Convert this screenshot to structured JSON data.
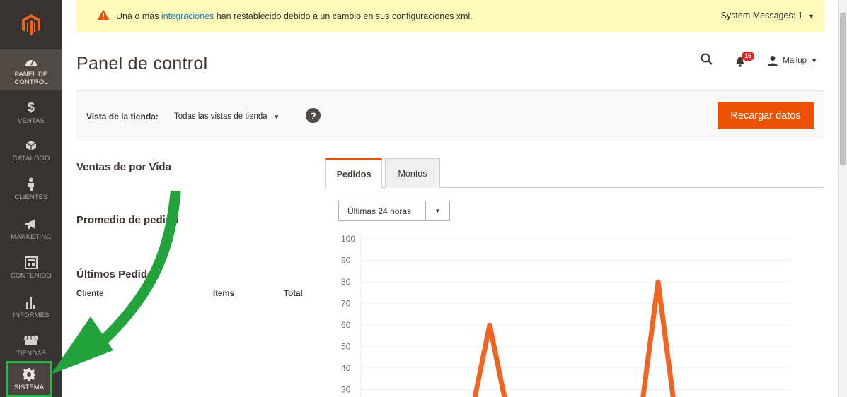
{
  "sidebar": {
    "items": [
      {
        "label_line1": "PANEL DE",
        "label_line2": "CONTROL",
        "icon": "dashboard-icon"
      },
      {
        "label_line1": "VENTAS",
        "label_line2": "",
        "icon": "dollar-icon"
      },
      {
        "label_line1": "CATÁLOGO",
        "label_line2": "",
        "icon": "cube-icon"
      },
      {
        "label_line1": "CLIENTES",
        "label_line2": "",
        "icon": "person-icon"
      },
      {
        "label_line1": "MARKETING",
        "label_line2": "",
        "icon": "megaphone-icon"
      },
      {
        "label_line1": "CONTENIDO",
        "label_line2": "",
        "icon": "layout-icon"
      },
      {
        "label_line1": "INFORMES",
        "label_line2": "",
        "icon": "bar-chart-icon"
      },
      {
        "label_line1": "TIENDAS",
        "label_line2": "",
        "icon": "store-icon"
      },
      {
        "label_line1": "SISTEMA",
        "label_line2": "",
        "icon": "gear-icon"
      }
    ]
  },
  "system_message": {
    "text_before": "Una o más ",
    "link": "integraciones",
    "text_after": " han restablecido debido a un cambio en sus configuraciones xml.",
    "counter": "System Messages: 1"
  },
  "header": {
    "title": "Panel de control",
    "notifications_count": "16",
    "user": "Mailup"
  },
  "store_bar": {
    "label": "Vista de la tienda:",
    "selected": "Todas las vistas de tienda",
    "reload_button": "Recargar datos"
  },
  "left": {
    "lifetime_sales": "Ventas de por Vida",
    "average_order": "Promedio de pedido",
    "last_orders": "Últimos Pedidos",
    "columns": [
      "Cliente",
      "Items",
      "Total"
    ]
  },
  "tabs": [
    "Pedidos",
    "Montos"
  ],
  "period": {
    "selected": "Últimas 24 horas"
  },
  "colors": {
    "accent": "#eb5202",
    "sidebar": "#373330",
    "line": "#f26322",
    "highlight": "#2cb34a"
  },
  "chart_data": {
    "type": "line",
    "y_ticks": [
      "100",
      "90",
      "80",
      "70",
      "60",
      "50",
      "40",
      "30"
    ],
    "ylim": [
      30,
      100
    ],
    "peaks": [
      {
        "index": 0,
        "value": 60
      },
      {
        "index": 1,
        "value": 80
      }
    ],
    "visible_range_note": ""
  }
}
